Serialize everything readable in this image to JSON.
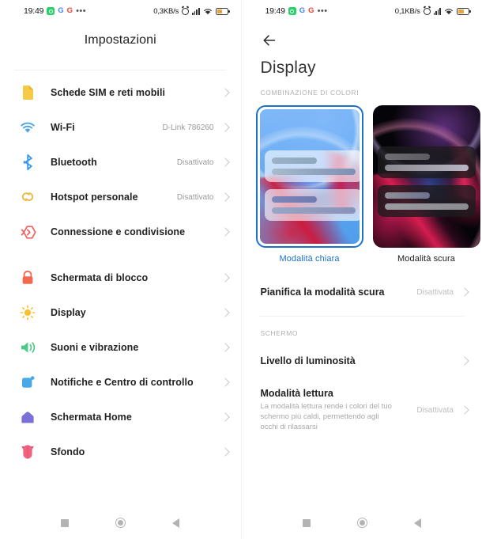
{
  "left": {
    "statusbar": {
      "time": "19:49",
      "icons": [
        "whatsapp-icon",
        "google-icon",
        "google-icon",
        "more-dots-icon"
      ],
      "network_speed": "0,3KB/s",
      "right_icons": [
        "alarm-icon",
        "signal-icon",
        "wifi-icon",
        "battery-icon"
      ]
    },
    "title": "Impostazioni",
    "items": [
      {
        "icon": "sim-card-icon",
        "label": "Schede SIM e reti mobili",
        "value": ""
      },
      {
        "icon": "wifi-icon",
        "label": "Wi-Fi",
        "value": "D-Link 786260"
      },
      {
        "icon": "bluetooth-icon",
        "label": "Bluetooth",
        "value": "Disattivato"
      },
      {
        "icon": "hotspot-icon",
        "label": "Hotspot personale",
        "value": "Disattivato"
      },
      {
        "icon": "connection-sharing-icon",
        "label": "Connessione e condivisione",
        "value": ""
      }
    ],
    "items2": [
      {
        "icon": "lock-icon",
        "label": "Schermata di blocco",
        "value": ""
      },
      {
        "icon": "brightness-icon",
        "label": "Display",
        "value": ""
      },
      {
        "icon": "volume-icon",
        "label": "Suoni e vibrazione",
        "value": ""
      },
      {
        "icon": "notifications-icon",
        "label": "Notifiche e Centro di controllo",
        "value": ""
      },
      {
        "icon": "home-screen-icon",
        "label": "Schermata Home",
        "value": ""
      },
      {
        "icon": "wallpaper-icon",
        "label": "Sfondo",
        "value": ""
      }
    ],
    "navbar": [
      "recents-square-icon",
      "home-circle-icon",
      "back-triangle-icon"
    ]
  },
  "right": {
    "statusbar": {
      "time": "19:49",
      "network_speed": "0,1KB/s"
    },
    "back_icon": "back-arrow-icon",
    "title": "Display",
    "section_colors": "COMBINAZIONE DI COLORI",
    "themes": [
      {
        "caption": "Modalità chiara",
        "selected": true
      },
      {
        "caption": "Modalità scura",
        "selected": false
      }
    ],
    "schedule_row": {
      "label": "Pianifica la modalità scura",
      "value": "Disattivata"
    },
    "section_screen": "SCHERMO",
    "brightness_row": {
      "label": "Livello di luminosità",
      "value": ""
    },
    "reading_row": {
      "label": "Modalità lettura",
      "sub": "La modalità lettura rende i colori del tuo schermo più caldi, permettendo agli occhi di rilassarsi",
      "value": "Disattivata"
    },
    "navbar": [
      "recents-square-icon",
      "home-circle-icon",
      "back-triangle-icon"
    ]
  },
  "colors": {
    "accent_blue": "#1a73c8",
    "sim_yellow": "#f5c24b",
    "wifi_blue": "#4ba3e3",
    "bluetooth_blue": "#3d9ae8",
    "hotspot_gold": "#e8bb4a",
    "connection_red": "#f06060",
    "lock_red": "#f4684f",
    "brightness_yellow": "#fbc02d",
    "volume_green": "#4dc98a",
    "notif_blue": "#49a8e8",
    "home_purple": "#7c6fd6",
    "wallpaper_pink": "#f0627f"
  }
}
